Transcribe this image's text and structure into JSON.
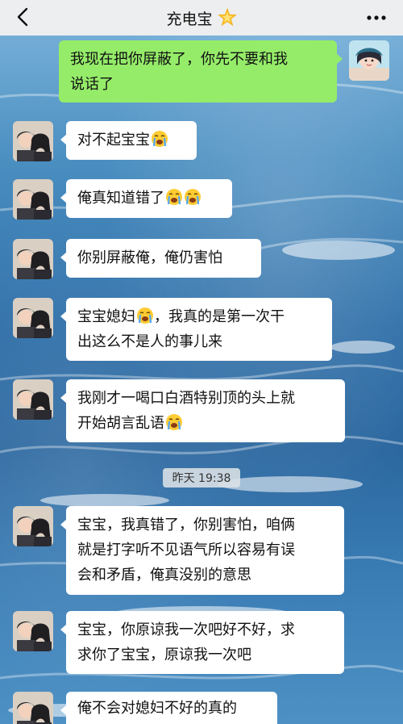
{
  "header": {
    "title": "充电宝",
    "title_icon": "sparkle-star-icon",
    "back_icon": "chevron-left-icon",
    "more_icon": "more-dots-icon"
  },
  "messages": [
    {
      "side": "right",
      "text_lines": [
        "我现在把你屏蔽了，你先不要和我",
        "说话了"
      ]
    },
    {
      "side": "left",
      "text": "对不起宝宝",
      "emoji": "crying-face-icon"
    },
    {
      "side": "left",
      "text": "俺真知道错了",
      "emoji": "crying-face-icon"
    },
    {
      "side": "left",
      "text": "你别屏蔽俺，俺仍害怕"
    },
    {
      "side": "left",
      "line1": "宝宝媳妇",
      "line1_after": "，我真的是第一次干",
      "line2": "出这么不是人的事儿来"
    },
    {
      "side": "left",
      "line1": "我刚才一喝口白酒特别顶的头上就",
      "line2": "开始胡言乱语"
    },
    {
      "side": "left",
      "line1": "宝宝，我真错了，你别害怕，咱俩",
      "line2": "就是打字听不见语气所以容易有误",
      "line3": "会和矛盾，俺真没别的意思"
    },
    {
      "side": "left",
      "line1": "宝宝，你原谅我一次吧好不好，求",
      "line2": "求你了宝宝，原谅我一次吧"
    },
    {
      "side": "left",
      "text": "俺不会对媳妇不好的真的"
    }
  ],
  "timestamp": "昨天 19:38",
  "colors": {
    "header_bg": "#efefef",
    "my_bubble": "#95ec69",
    "their_bubble": "#ffffff"
  }
}
